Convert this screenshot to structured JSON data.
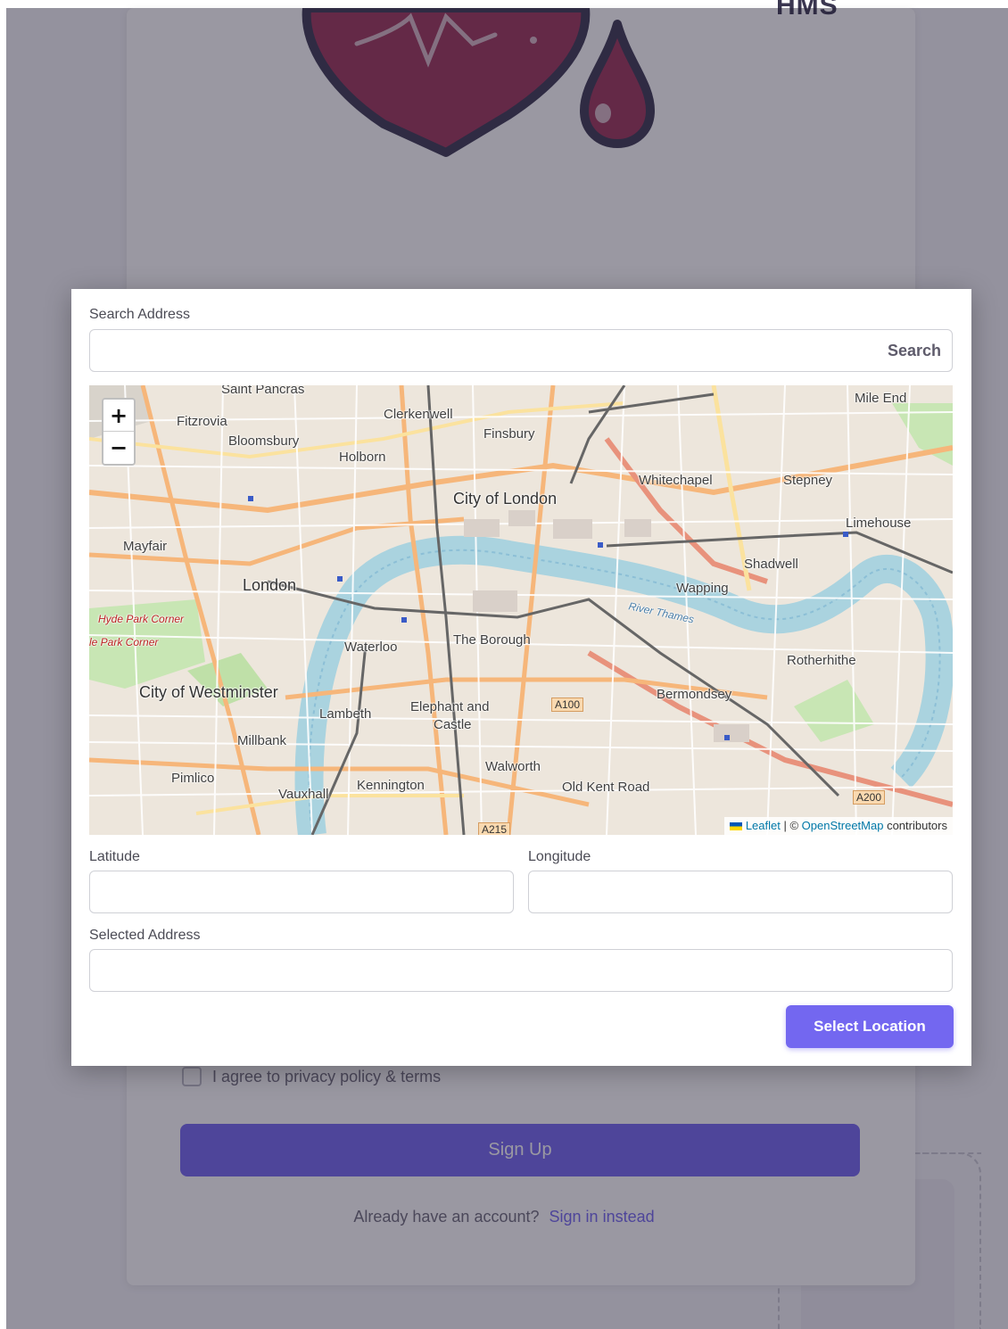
{
  "background": {
    "app_abbrev": "HMS",
    "agree_label": "I agree to privacy policy & terms",
    "signup_label": "Sign Up",
    "signin_question": "Already have an account?",
    "signin_link": "Sign in instead",
    "brand_color": "#7367f0",
    "logo_color": "#9b3358"
  },
  "modal": {
    "search_label": "Search Address",
    "search_value": "",
    "search_button": "Search",
    "latitude_label": "Latitude",
    "latitude_value": "",
    "longitude_label": "Longitude",
    "longitude_value": "",
    "address_label": "Selected Address",
    "address_value": "",
    "select_button": "Select Location"
  },
  "map": {
    "zoom_in": "+",
    "zoom_out": "−",
    "attribution": {
      "leaflet": "Leaflet",
      "separator": " | © ",
      "osm": "OpenStreetMap",
      "suffix": " contributors"
    },
    "places": {
      "saint_pancras": "Saint Pancras",
      "fitzrovia": "Fitzrovia",
      "bloomsbury": "Bloomsbury",
      "clerkenwell": "Clerkenwell",
      "finsbury": "Finsbury",
      "holborn": "Holborn",
      "mile_end": "Mile End",
      "whitechapel": "Whitechapel",
      "stepney": "Stepney",
      "city_of_london": "City of London",
      "limehouse": "Limehouse",
      "mayfair": "Mayfair",
      "shadwell": "Shadwell",
      "london": "London",
      "wapping": "Wapping",
      "hyde_park_corner_1": "Hyde Park Corner",
      "hyde_park_corner_2": "le Park Corner",
      "waterloo": "Waterloo",
      "the_borough": "The Borough",
      "rotherhithe": "Rotherhithe",
      "city_of_westminster": "City of Westminster",
      "bermondsey": "Bermondsey",
      "lambeth": "Lambeth",
      "elephant_and_castle_1": "Elephant and",
      "elephant_and_castle_2": "Castle",
      "millbank": "Millbank",
      "walworth": "Walworth",
      "pimlico": "Pimlico",
      "kennington": "Kennington",
      "old_kent_road": "Old Kent Road",
      "vauxhall": "Vauxhall",
      "river_thames": "River Thames"
    },
    "roads": {
      "a100": "A100",
      "a200": "A200",
      "a215": "A215"
    }
  }
}
